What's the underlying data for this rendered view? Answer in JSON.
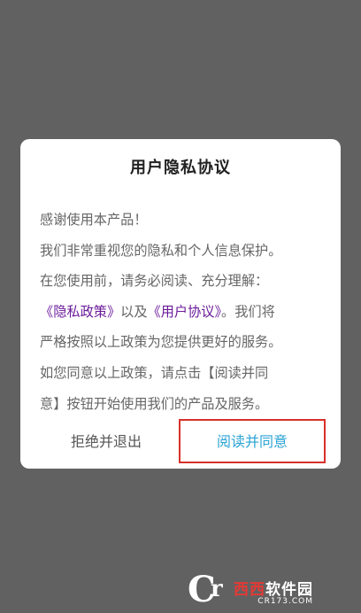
{
  "dialog": {
    "title": "用户隐私协议",
    "lines": [
      "感谢使用本产品！",
      "我们非常重视您的隐私和个人信息保护。",
      "在您使用前，请务必阅读、充分理解："
    ],
    "line4": {
      "privacy_link": "《隐私政策》",
      "connector": "以及",
      "agreement_link": "《用户协议》",
      "tail": "。我们将"
    },
    "lines_after": [
      "严格按照以上政策为您提供更好的服务。",
      "如您同意以上政策，请点击【阅读并同",
      "意】按钮开始使用我们的产品及服务。"
    ],
    "refuse_label": "拒绝并退出",
    "agree_label": "阅读并同意"
  },
  "watermark": {
    "logo_c": "C",
    "logo_r": "r",
    "brand_red": "西西",
    "brand_white": "软件园",
    "domain": "CR173.COM"
  },
  "colors": {
    "backdrop": "#616161",
    "link": "#6a1b9a",
    "agree": "#2aa3d5",
    "highlight": "#d9302b"
  }
}
